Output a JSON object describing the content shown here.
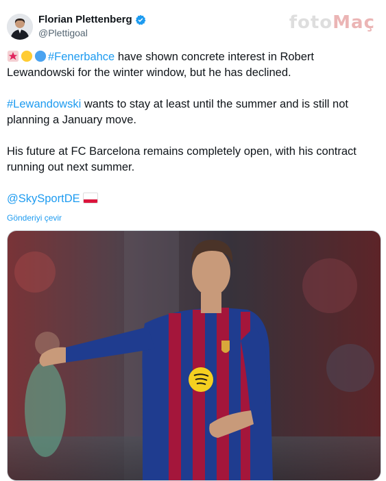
{
  "author": {
    "display_name": "Florian Plettenberg",
    "handle": "@Plettigoal",
    "verified": true,
    "avatar_icon": "avatar-photo"
  },
  "watermark": {
    "part1": "foto",
    "part2": "Maç",
    "part3": ""
  },
  "tweet": {
    "p1_emojis": [
      "siren-emoji",
      "yellow-circle-emoji",
      "blue-circle-emoji"
    ],
    "p1_hashtag": "#Fenerbahce",
    "p1_text": " have shown concrete interest in Robert Lewandowski for the winter window, but he has declined.",
    "p2_hashtag": "#Lewandowski",
    "p2_text": " wants to stay at least until the summer and is still not planning a January move.",
    "p3_text": "His future at FC Barcelona remains completely open, with his contract running out next summer.",
    "p4_mention": "@SkySportDE",
    "p4_flag": "poland-flag",
    "translate_label": "Gönderiyi çevir"
  },
  "media": {
    "alt": "photo"
  },
  "colors": {
    "link": "#1d9bf0",
    "secondary_text": "#536471",
    "barca_blue": "#1f3c8f",
    "barca_red": "#a4163b"
  }
}
